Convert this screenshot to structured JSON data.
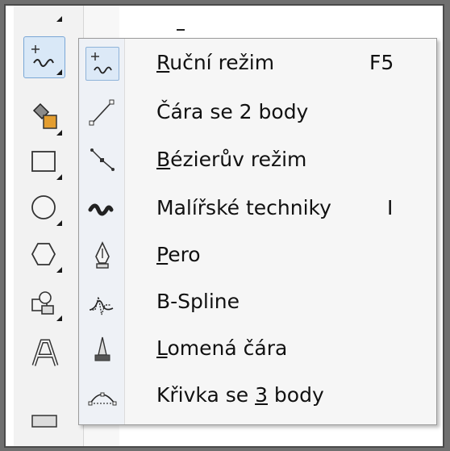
{
  "menu": {
    "items": [
      {
        "pre": "",
        "u": "R",
        "post": "uční režim",
        "shortcut": "F5",
        "icon": "freehand-icon"
      },
      {
        "pre": "Čára se 2 body",
        "u": "",
        "post": "",
        "shortcut": "",
        "icon": "two-point-line-icon"
      },
      {
        "pre": "",
        "u": "B",
        "post": "ézierův režim",
        "shortcut": "",
        "icon": "bezier-icon"
      },
      {
        "pre": "Malířské techniky",
        "u": "",
        "post": "",
        "shortcut": "I",
        "icon": "artistic-media-icon"
      },
      {
        "pre": "",
        "u": "P",
        "post": "ero",
        "shortcut": "",
        "icon": "pen-icon"
      },
      {
        "pre": "B-Spline",
        "u": "",
        "post": "",
        "shortcut": "",
        "icon": "bspline-icon"
      },
      {
        "pre": "",
        "u": "L",
        "post": "omená čára",
        "shortcut": "",
        "icon": "polyline-icon"
      },
      {
        "pre": "Křivka se ",
        "u": "3",
        "post": " body",
        "shortcut": "",
        "icon": "three-point-curve-icon"
      }
    ]
  },
  "toolbox": {
    "tools": [
      "freehand-tool-icon",
      "smart-fill-icon",
      "rectangle-icon",
      "ellipse-icon",
      "polygon-icon",
      "basic-shapes-icon",
      "text-icon"
    ]
  },
  "colors": {
    "accent": "#7aa7d6",
    "highlight": "#d9e8f7",
    "menu_bg": "#f6f6f6"
  }
}
